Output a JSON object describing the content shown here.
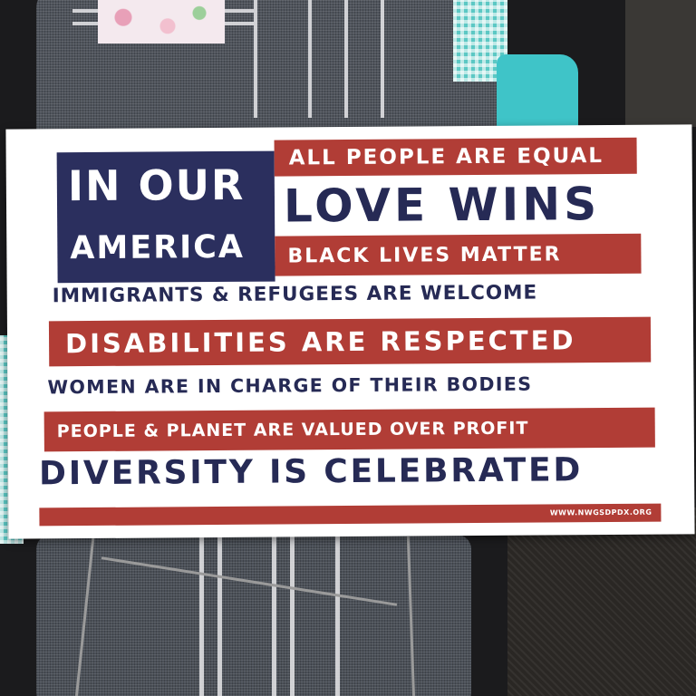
{
  "sign": {
    "top_left": {
      "line1": "IN OUR",
      "line2": "AMERICA"
    },
    "statements": [
      "ALL PEOPLE ARE EQUAL",
      "LOVE WINS",
      "BLACK LIVES MATTER",
      "IMMIGRANTS & REFUGEES ARE WELCOME",
      "DISABILITIES ARE RESPECTED",
      "WOMEN ARE IN CHARGE OF THEIR BODIES",
      "PEOPLE & PLANET ARE VALUED OVER PROFIT",
      "DIVERSITY IS CELEBRATED"
    ],
    "website": "WWW.NWGSDPDX.ORG"
  },
  "colors": {
    "red_bar": "#b13d36",
    "navy_text": "#262a55",
    "blue_box": "#2b2f5e",
    "sign_background": "#ffffff"
  }
}
